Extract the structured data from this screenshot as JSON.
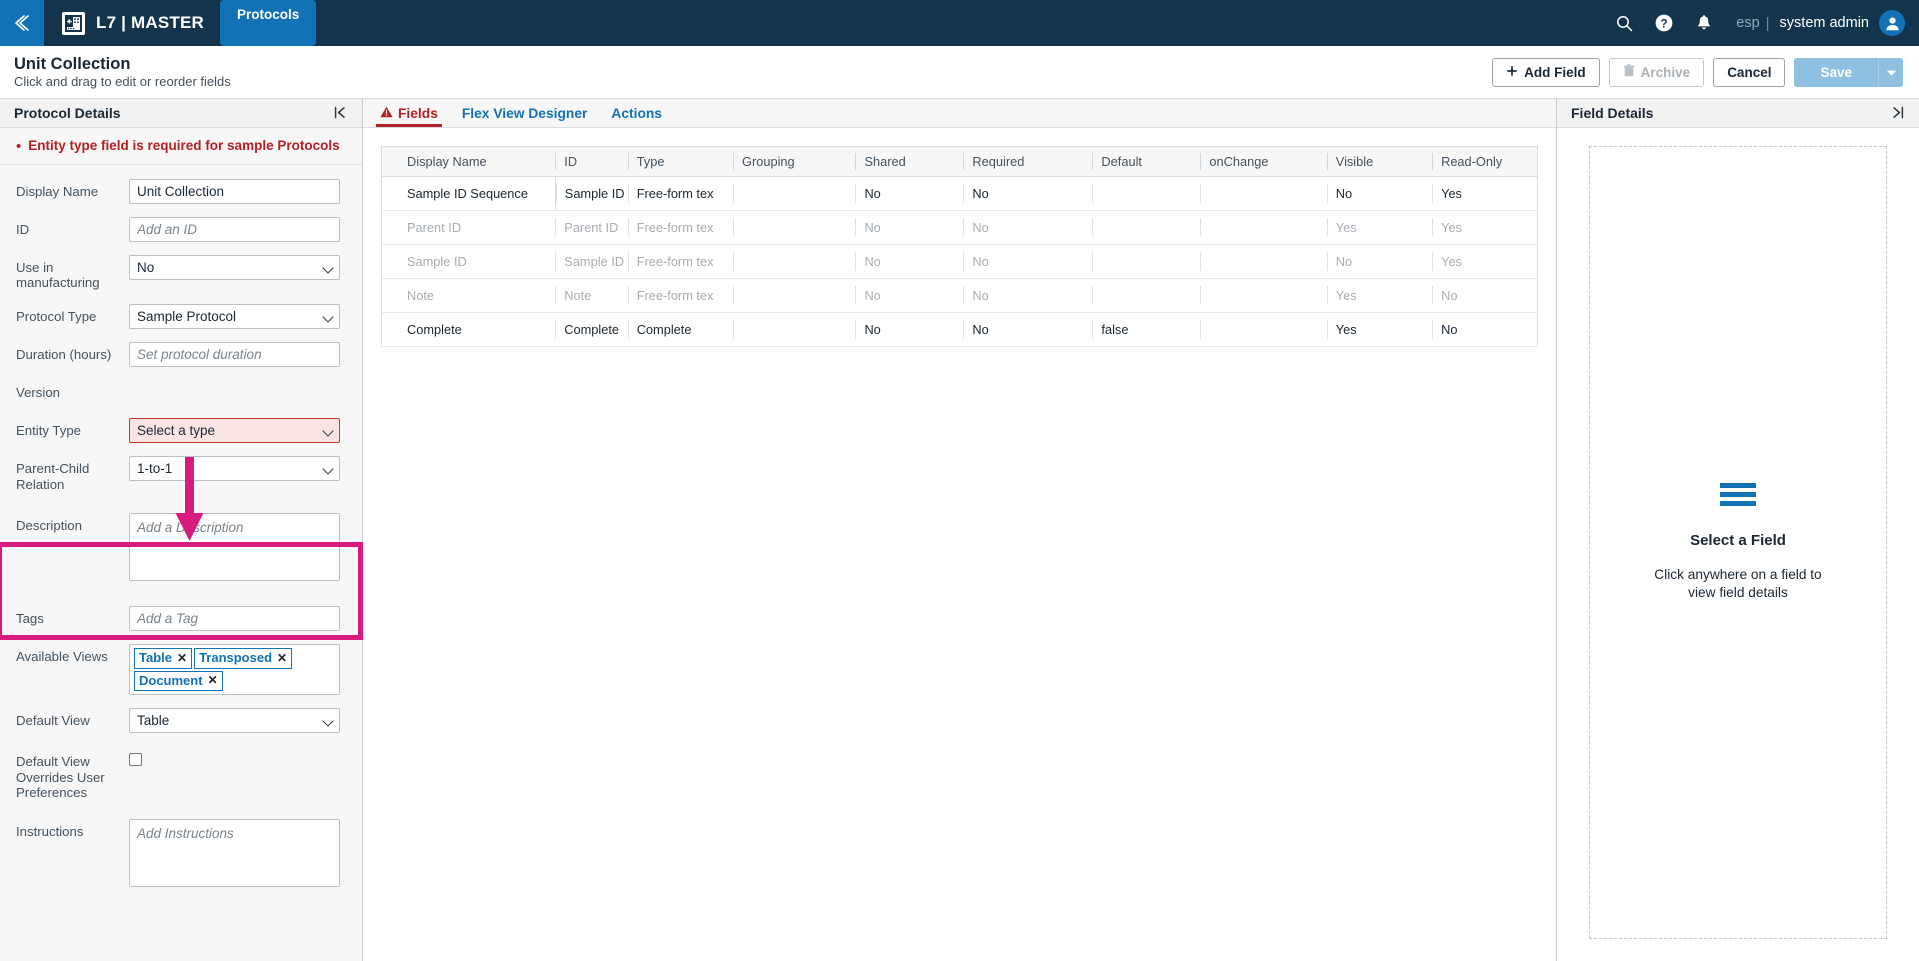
{
  "topnav": {
    "back_icon": "chevron-double-left-icon",
    "logo_icon": "l7-building-icon",
    "brand": "L7 | MASTER",
    "active_tab": "Protocols",
    "search_icon": "search-icon",
    "help_icon": "question-circle-icon",
    "bell_icon": "bell-icon",
    "language": "esp",
    "separator": "|",
    "user": "system admin",
    "avatar_icon": "user-avatar-icon"
  },
  "pagehead": {
    "title": "Unit Collection",
    "subtitle": "Click and drag to edit or reorder fields",
    "add_field": "Add Field",
    "add_field_icon": "plus-icon",
    "archive": "Archive",
    "archive_icon": "trash-icon",
    "cancel": "Cancel",
    "save": "Save",
    "save_caret_icon": "caret-down-icon"
  },
  "left_panel": {
    "title": "Protocol Details",
    "collapse_icon": "collapse-left-icon",
    "error": "Entity type field is required for sample Protocols",
    "fields": {
      "display_name": {
        "label": "Display Name",
        "value": "Unit Collection"
      },
      "id": {
        "label": "ID",
        "placeholder": "Add an ID"
      },
      "use_in_manufacturing": {
        "label": "Use in manufacturing",
        "value": "No"
      },
      "protocol_type": {
        "label": "Protocol Type",
        "value": "Sample Protocol"
      },
      "duration": {
        "label": "Duration (hours)",
        "placeholder": "Set protocol duration"
      },
      "version": {
        "label": "Version"
      },
      "entity_type": {
        "label": "Entity Type",
        "value": "Select a type"
      },
      "parent_child_relation": {
        "label": "Parent-Child Relation",
        "value": "1-to-1"
      },
      "description": {
        "label": "Description",
        "placeholder": "Add a Description"
      },
      "tags": {
        "label": "Tags",
        "placeholder": "Add a Tag"
      },
      "available_views": {
        "label": "Available Views",
        "tags": [
          "Table",
          "Transposed",
          "Document"
        ]
      },
      "default_view": {
        "label": "Default View",
        "value": "Table"
      },
      "default_view_overrides": {
        "label": "Default View Overrides User Preferences",
        "checked": false
      },
      "instructions": {
        "label": "Instructions",
        "placeholder": "Add Instructions"
      }
    }
  },
  "center_panel": {
    "tabs": [
      {
        "label": "Fields",
        "active": true,
        "icon": "warning-triangle-icon"
      },
      {
        "label": "Flex View Designer",
        "active": false
      },
      {
        "label": "Actions",
        "active": false
      }
    ],
    "table": {
      "columns": [
        "Display Name",
        "ID",
        "Type",
        "Grouping",
        "Shared",
        "Required",
        "Default",
        "onChange",
        "Visible",
        "Read-Only"
      ],
      "rows": [
        {
          "dim": false,
          "cells": [
            "Sample ID Sequence",
            "Sample ID",
            "Free-form tex",
            "",
            "No",
            "No",
            "",
            "",
            "No",
            "Yes"
          ]
        },
        {
          "dim": true,
          "cells": [
            "Parent ID",
            "Parent ID",
            "Free-form tex",
            "",
            "No",
            "No",
            "",
            "",
            "Yes",
            "Yes"
          ]
        },
        {
          "dim": true,
          "cells": [
            "Sample ID",
            "Sample ID",
            "Free-form tex",
            "",
            "No",
            "No",
            "",
            "",
            "No",
            "Yes"
          ]
        },
        {
          "dim": true,
          "cells": [
            "Note",
            "Note",
            "Free-form tex",
            "",
            "No",
            "No",
            "",
            "",
            "Yes",
            "No"
          ]
        },
        {
          "dim": false,
          "cells": [
            "Complete",
            "Complete",
            "Complete",
            "",
            "No",
            "No",
            "false",
            "",
            "Yes",
            "No"
          ]
        }
      ]
    }
  },
  "right_panel": {
    "title": "Field Details",
    "collapse_icon": "collapse-right-icon",
    "empty_icon": "list-lines-icon",
    "empty_title": "Select a Field",
    "empty_subtitle": "Click anywhere on a field to view field details"
  },
  "annotation": {
    "color": "#d81b7e",
    "arrow_icon": "down-arrow-annotation",
    "box_icon": "highlight-box-annotation"
  },
  "colors": {
    "nav_bg": "#12344d",
    "accent_blue": "#1272b5",
    "error_red": "#b32025",
    "annotation_pink": "#d81b7e"
  }
}
